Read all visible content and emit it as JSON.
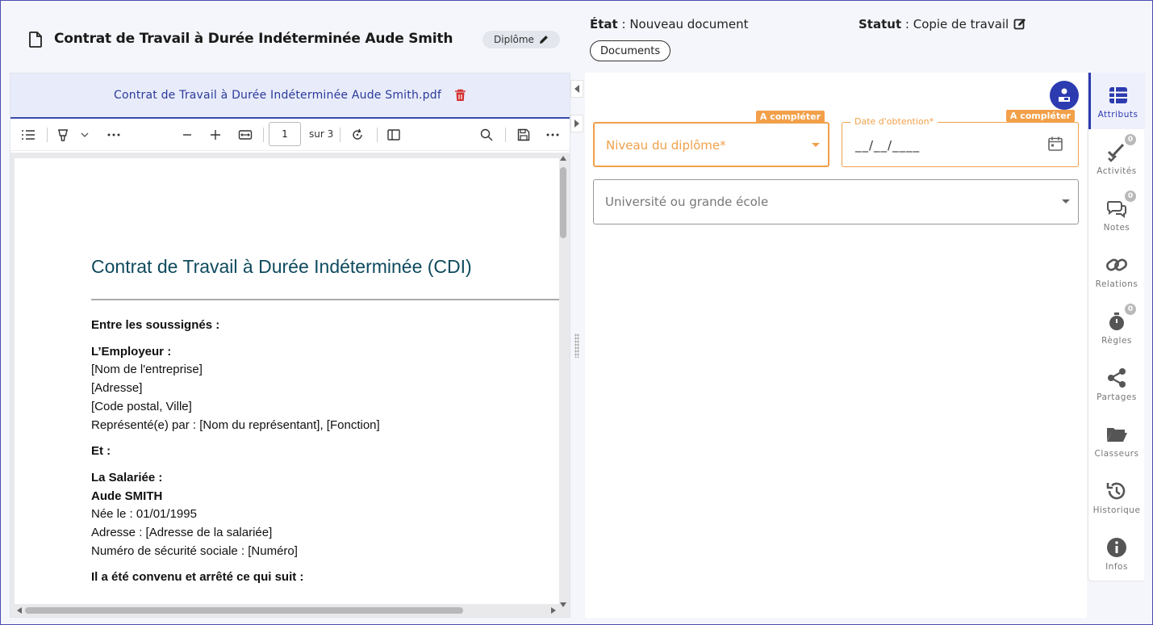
{
  "header": {
    "title": "Contrat de Travail à Durée Indéterminée Aude Smith",
    "type_badge": "Diplôme",
    "etat_label": "État",
    "etat_value": "Nouveau document",
    "statut_label": "Statut",
    "statut_value": "Copie de travail",
    "documents_button": "Documents"
  },
  "pdf": {
    "filename": "Contrat de Travail à Durée Indéterminée Aude Smith.pdf",
    "current_page": "1",
    "page_total": "sur 3",
    "heading": "Contrat de Travail à Durée Indéterminée (CDI)",
    "lines": {
      "entre": "Entre les soussignés :",
      "employeur": "L’Employeur :",
      "nom_entreprise": "[Nom de l'entreprise]",
      "adresse": "[Adresse]",
      "code_postal": "[Code postal, Ville]",
      "represente": "Représenté(e) par : [Nom du représentant], [Fonction]",
      "et": "Et :",
      "salariee": "La Salariée :",
      "nom_salariee": "Aude SMITH",
      "nee_le": "Née le : 01/01/1995",
      "adresse_salariee": "Adresse : [Adresse de la salariée]",
      "secu": "Numéro de sécurité sociale : [Numéro]",
      "convenu": "Il a été convenu et arrêté ce qui suit :"
    }
  },
  "form": {
    "niveau": {
      "label": "Niveau du diplôme*",
      "badge": "A compléter"
    },
    "date": {
      "label": "Date d'obtention*",
      "value": "__/__/____",
      "badge": "A compléter"
    },
    "universite": {
      "placeholder": "Université ou grande école"
    }
  },
  "sidebar": {
    "items": [
      {
        "label": "Attributs",
        "count": null
      },
      {
        "label": "Activités",
        "count": "0"
      },
      {
        "label": "Notes",
        "count": "0"
      },
      {
        "label": "Relations",
        "count": null
      },
      {
        "label": "Règles",
        "count": "0"
      },
      {
        "label": "Partages",
        "count": null
      },
      {
        "label": "Classeurs",
        "count": null
      },
      {
        "label": "Historique",
        "count": null
      },
      {
        "label": "Infos",
        "count": null
      }
    ]
  },
  "colors": {
    "accent": "#2c3bb0",
    "warning": "#f0a04b",
    "danger": "#d32f2f",
    "pdf_heading": "#0e4a5e"
  }
}
